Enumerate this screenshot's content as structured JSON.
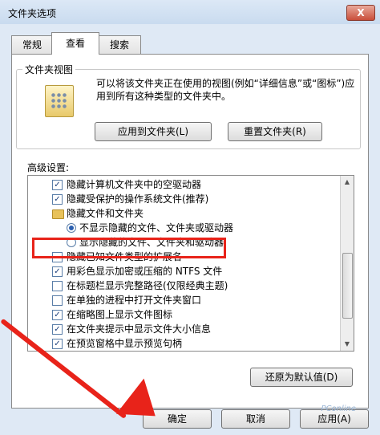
{
  "window": {
    "title": "文件夹选项",
    "close_label": "X"
  },
  "tabs": [
    {
      "label": "常规"
    },
    {
      "label": "查看"
    },
    {
      "label": "搜索"
    }
  ],
  "folder_view": {
    "group_label": "文件夹视图",
    "description": "可以将该文件夹正在使用的视图(例如“详细信息”或“图标”)应用到所有这种类型的文件夹中。",
    "apply_button": "应用到文件夹(L)",
    "reset_button": "重置文件夹(R)"
  },
  "advanced": {
    "label": "高级设置:",
    "items": [
      {
        "text": "隐藏计算机文件夹中的空驱动器",
        "type": "checkbox",
        "checked": true
      },
      {
        "text": "隐藏受保护的操作系统文件(推荐)",
        "type": "checkbox",
        "checked": true
      },
      {
        "text": "隐藏文件和文件夹",
        "type": "folder"
      },
      {
        "text": "不显示隐藏的文件、文件夹或驱动器",
        "type": "radio",
        "checked": true
      },
      {
        "text": "显示隐藏的文件、文件夹和驱动器",
        "type": "radio",
        "checked": false
      },
      {
        "text": "隐藏已知文件类型的扩展名",
        "type": "checkbox",
        "checked": false
      },
      {
        "text": "用彩色显示加密或压缩的 NTFS 文件",
        "type": "checkbox",
        "checked": true
      },
      {
        "text": "在标题栏显示完整路径(仅限经典主题)",
        "type": "checkbox",
        "checked": false
      },
      {
        "text": "在单独的进程中打开文件夹窗口",
        "type": "checkbox",
        "checked": false
      },
      {
        "text": "在缩略图上显示文件图标",
        "type": "checkbox",
        "checked": true
      },
      {
        "text": "在文件夹提示中显示文件大小信息",
        "type": "checkbox",
        "checked": true
      },
      {
        "text": "在预览窗格中显示预览句柄",
        "type": "checkbox",
        "checked": true
      }
    ],
    "restore_button": "还原为默认值(D)"
  },
  "footer": {
    "ok": "确定",
    "cancel": "取消",
    "apply": "应用(A)"
  },
  "watermark": "PConline",
  "colors": {
    "annotation": "#e8231a"
  }
}
